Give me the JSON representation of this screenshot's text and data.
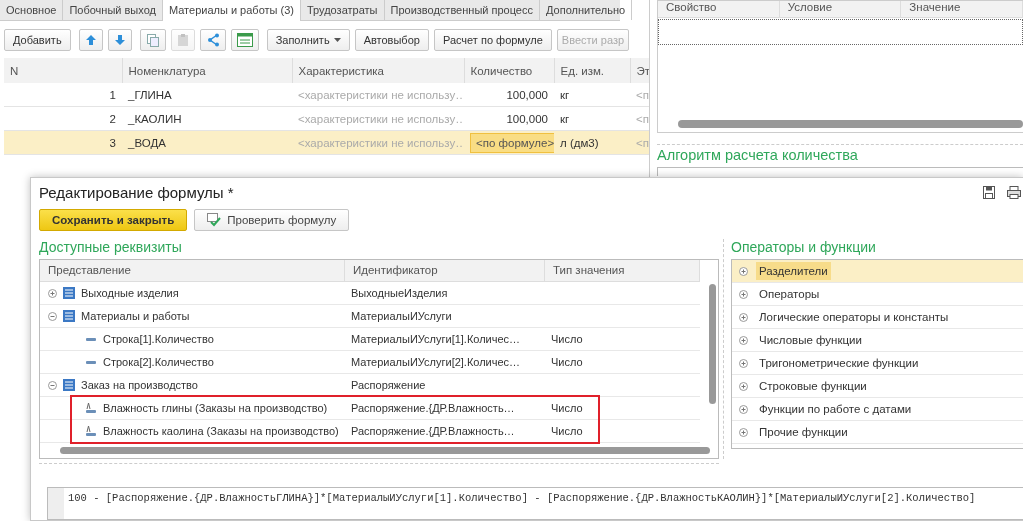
{
  "main_window": {
    "tabs": [
      {
        "label": "Основное",
        "selected": false
      },
      {
        "label": "Побочный выход",
        "selected": false
      },
      {
        "label": "Материалы и работы (3)",
        "selected": true
      },
      {
        "label": "Трудозатраты",
        "selected": false
      },
      {
        "label": "Производственный процесс",
        "selected": false
      },
      {
        "label": "Дополнительно",
        "selected": false
      }
    ],
    "toolbar": [
      {
        "kind": "text",
        "label": "Добавить",
        "disabled": false
      },
      {
        "kind": "up",
        "disabled": false
      },
      {
        "kind": "down",
        "disabled": false
      },
      {
        "kind": "copy",
        "disabled": false
      },
      {
        "kind": "paste",
        "disabled": true
      },
      {
        "kind": "hierarchy",
        "disabled": false
      },
      {
        "kind": "table",
        "disabled": false
      },
      {
        "kind": "menu",
        "label": "Заполнить",
        "disabled": false
      },
      {
        "kind": "text",
        "label": "Автовыбор",
        "disabled": false
      },
      {
        "kind": "text",
        "label": "Расчет по формуле",
        "disabled": false
      },
      {
        "kind": "text",
        "label": "Ввести разр",
        "disabled": true
      }
    ],
    "table": {
      "columns": [
        "N",
        "Номенклатура",
        "Характеристика",
        "Количество",
        "Ед. изм.",
        "Эт"
      ],
      "rows": [
        {
          "cells": [
            "1",
            "_ГЛИНА",
            "<характеристики не использу…",
            "100,000",
            "кг",
            "<п"
          ],
          "selected": false,
          "editing": false
        },
        {
          "cells": [
            "2",
            "_КАОЛИН",
            "<характеристики не использу…",
            "100,000",
            "кг",
            "<п"
          ],
          "selected": false,
          "editing": false
        },
        {
          "cells": [
            "3",
            "_ВОДА",
            "<характеристики не использу…",
            "<по формуле>",
            "л (дм3)",
            "<п"
          ],
          "selected": true,
          "editing": true
        }
      ]
    },
    "properties": {
      "columns": [
        "Свойство",
        "Условие",
        "Значение"
      ]
    },
    "algorithm_heading": "Алгоритм расчета количества"
  },
  "dialog": {
    "title": "Редактирование формулы *",
    "buttons": [
      {
        "kind": "default",
        "label": "Сохранить и закрыть"
      },
      {
        "kind": "check",
        "label": "Проверить формулу"
      }
    ],
    "attributes": {
      "heading": "Доступные реквизиты",
      "columns": [
        "Представление",
        "Идентификатор",
        "Тип значения"
      ],
      "rows": [
        {
          "kind": "group",
          "label": "Выходные изделия",
          "identifier": "ВыходныеИзделия",
          "expanded": false,
          "highlighted": false
        },
        {
          "kind": "group",
          "label": "Материалы и работы",
          "identifier": "МатериалыИУслуги",
          "expanded": true,
          "highlighted": false,
          "children": [
            {
              "kind": "field",
              "label": "Строка[1].Количество",
              "identifier": "МатериалыИУслуги[1].Количес…",
              "type": "Число",
              "highlighted": false
            },
            {
              "kind": "field",
              "label": "Строка[2].Количество",
              "identifier": "МатериалыИУслуги[2].Количес…",
              "type": "Число",
              "highlighted": false
            }
          ]
        },
        {
          "kind": "group",
          "label": "Заказ на производство",
          "identifier": "Распоряжение",
          "expanded": true,
          "highlighted": false,
          "children": [
            {
              "kind": "attribute",
              "label": "Влажность глины (Заказы на производство)",
              "identifier": "Распоряжение.{ДР.Влажность…",
              "type": "Число",
              "highlighted": true
            },
            {
              "kind": "attribute",
              "label": "Влажность каолина (Заказы на производство)",
              "identifier": "Распоряжение.{ДР.Влажность…",
              "type": "Число",
              "highlighted": true
            }
          ]
        }
      ]
    },
    "operators": {
      "heading": "Операторы и функции",
      "items": [
        {
          "label": "Разделители",
          "selected": true
        },
        {
          "label": "Операторы",
          "selected": false
        },
        {
          "label": "Логические операторы и константы",
          "selected": false
        },
        {
          "label": "Числовые функции",
          "selected": false
        },
        {
          "label": "Тригонометрические функции",
          "selected": false
        },
        {
          "label": "Строковые функции",
          "selected": false
        },
        {
          "label": "Функции по работе с датами",
          "selected": false
        },
        {
          "label": "Прочие функции",
          "selected": false
        }
      ]
    },
    "formula": "100 - [Распоряжение.{ДР.ВлажностьГЛИНА}]*[МатериалыИУслуги[1].Количество] - [Распоряжение.{ДР.ВлажностьКАОЛИН}]*[МатериалыИУслуги[2].Количество]"
  }
}
